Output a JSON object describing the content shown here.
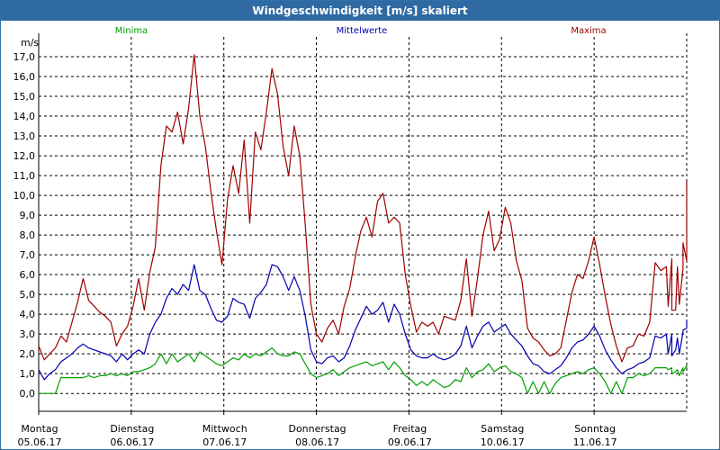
{
  "window": {
    "title": "Windgeschwindigkeit [m/s] skaliert"
  },
  "colors": {
    "min": "#00a000",
    "mean": "#0000b0",
    "max": "#a00000",
    "grid": "#000000",
    "titlebar": "#2f6aa3"
  },
  "chart_data": {
    "type": "line",
    "title": "Windgeschwindigkeit [m/s] skaliert",
    "ylabel": "m/s",
    "ylim": [
      -0.9,
      18.0
    ],
    "xlim": [
      0,
      7
    ],
    "yticks": [
      "0,0",
      "1,0",
      "2,0",
      "3,0",
      "4,0",
      "5,0",
      "6,0",
      "7,0",
      "8,0",
      "9,0",
      "10,0",
      "11,0",
      "12,0",
      "13,0",
      "14,0",
      "15,0",
      "16,0",
      "17,0"
    ],
    "x_ticks": [
      {
        "day": "Montag",
        "date": "05.06.17"
      },
      {
        "day": "Dienstag",
        "date": "06.06.17"
      },
      {
        "day": "Mittwoch",
        "date": "07.06.17"
      },
      {
        "day": "Donnerstag",
        "date": "08.06.17"
      },
      {
        "day": "Freitag",
        "date": "09.06.17"
      },
      {
        "day": "Samstag",
        "date": "10.06.17"
      },
      {
        "day": "Sonntag",
        "date": "11.06.17"
      }
    ],
    "grid": true,
    "legend": [
      "Minima",
      "Mittelwerte",
      "Maxima"
    ],
    "series": [
      {
        "name": "Maxima",
        "x": [
          0,
          0.06,
          0.12,
          0.18,
          0.24,
          0.3,
          0.36,
          0.42,
          0.48,
          0.54,
          0.6,
          0.66,
          0.72,
          0.78,
          0.84,
          0.9,
          0.96,
          1.02,
          1.08,
          1.14,
          1.2,
          1.26,
          1.32,
          1.38,
          1.44,
          1.5,
          1.56,
          1.62,
          1.68,
          1.74,
          1.8,
          1.86,
          1.92,
          1.98,
          2.04,
          2.1,
          2.16,
          2.22,
          2.28,
          2.34,
          2.4,
          2.46,
          2.52,
          2.58,
          2.64,
          2.7,
          2.76,
          2.82,
          2.88,
          2.94,
          3.0,
          3.06,
          3.12,
          3.18,
          3.24,
          3.3,
          3.36,
          3.42,
          3.48,
          3.54,
          3.6,
          3.66,
          3.72,
          3.78,
          3.84,
          3.9,
          3.96,
          4.02,
          4.08,
          4.14,
          4.2,
          4.26,
          4.32,
          4.38,
          4.44,
          4.5,
          4.56,
          4.62,
          4.68,
          4.74,
          4.8,
          4.86,
          4.92,
          4.98,
          5.04,
          5.1,
          5.16,
          5.22,
          5.28,
          5.34,
          5.4,
          5.46,
          5.52,
          5.58,
          5.64,
          5.7,
          5.76,
          5.82,
          5.88,
          5.94,
          6.0,
          6.06,
          6.12,
          6.18,
          6.24,
          6.3,
          6.36,
          6.42,
          6.48,
          6.54,
          6.6,
          6.66,
          6.72,
          6.78,
          6.84,
          6.9,
          6.96,
          7.0
        ],
        "values": [
          2.4,
          1.7,
          2.0,
          2.3,
          2.9,
          2.6,
          3.6,
          4.6,
          5.8,
          4.7,
          4.4,
          4.1,
          3.9,
          3.6,
          2.4,
          3.0,
          3.4,
          4.4,
          5.8,
          4.2,
          6.1,
          7.4,
          11.5,
          13.5,
          13.2,
          14.2,
          12.6,
          14.4,
          17.1,
          14.0,
          12.5,
          10.2,
          8.2,
          6.5,
          9.8,
          11.5,
          10.1,
          12.8,
          8.6,
          13.2,
          12.3,
          14.2,
          16.4,
          15.1,
          12.5,
          11.0,
          13.5,
          12.0,
          8.5,
          4.5,
          3.0,
          2.6,
          3.3,
          3.7,
          3.0,
          4.4,
          5.3,
          6.9,
          8.2,
          8.9,
          7.9,
          9.7,
          10.1,
          8.6,
          8.9,
          8.6,
          6.0,
          4.4,
          3.1,
          3.6,
          3.4,
          3.6,
          3.0,
          3.9,
          3.8,
          3.7,
          4.7,
          6.8,
          3.9,
          5.8,
          8.0,
          9.2,
          7.2,
          7.8,
          9.4,
          8.6,
          6.7,
          5.7,
          3.3,
          2.8,
          2.6,
          2.2,
          1.9,
          2.0,
          2.3,
          3.7,
          5.1,
          6.0,
          5.8,
          6.7,
          7.9,
          6.5,
          4.9,
          3.5,
          2.4,
          1.6,
          2.3,
          2.4,
          3.0,
          2.9,
          3.6,
          6.6,
          6.2,
          6.4,
          6.8,
          6.4,
          6.3,
          6.7
        ],
        "tail": [
          4.4,
          4.2,
          4.2,
          4.5,
          7.6,
          10.7
        ]
      },
      {
        "name": "Mittelwerte",
        "x": [
          0,
          0.06,
          0.12,
          0.18,
          0.24,
          0.3,
          0.36,
          0.42,
          0.48,
          0.54,
          0.6,
          0.66,
          0.72,
          0.78,
          0.84,
          0.9,
          0.96,
          1.02,
          1.08,
          1.14,
          1.2,
          1.26,
          1.32,
          1.38,
          1.44,
          1.5,
          1.56,
          1.62,
          1.68,
          1.74,
          1.8,
          1.86,
          1.92,
          1.98,
          2.04,
          2.1,
          2.16,
          2.22,
          2.28,
          2.34,
          2.4,
          2.46,
          2.52,
          2.58,
          2.64,
          2.7,
          2.76,
          2.82,
          2.88,
          2.94,
          3.0,
          3.06,
          3.12,
          3.18,
          3.24,
          3.3,
          3.36,
          3.42,
          3.48,
          3.54,
          3.6,
          3.66,
          3.72,
          3.78,
          3.84,
          3.9,
          3.96,
          4.02,
          4.08,
          4.14,
          4.2,
          4.26,
          4.32,
          4.38,
          4.44,
          4.5,
          4.56,
          4.62,
          4.68,
          4.74,
          4.8,
          4.86,
          4.92,
          4.98,
          5.04,
          5.1,
          5.16,
          5.22,
          5.28,
          5.34,
          5.4,
          5.46,
          5.52,
          5.58,
          5.64,
          5.7,
          5.76,
          5.82,
          5.88,
          5.94,
          6.0,
          6.06,
          6.12,
          6.18,
          6.24,
          6.3,
          6.36,
          6.42,
          6.48,
          6.54,
          6.6,
          6.66,
          6.72,
          6.78,
          6.84,
          6.9,
          6.96,
          7.0
        ],
        "values": [
          1.2,
          0.7,
          1.0,
          1.2,
          1.6,
          1.8,
          2.0,
          2.3,
          2.5,
          2.3,
          2.2,
          2.1,
          2.0,
          1.9,
          1.6,
          2.0,
          1.7,
          2.0,
          2.2,
          2.0,
          3.0,
          3.6,
          4.0,
          4.8,
          5.3,
          5.0,
          5.5,
          5.2,
          6.5,
          5.2,
          5.0,
          4.3,
          3.7,
          3.6,
          3.9,
          4.8,
          4.6,
          4.5,
          3.8,
          4.8,
          5.1,
          5.5,
          6.5,
          6.4,
          5.9,
          5.2,
          5.9,
          5.2,
          3.9,
          2.2,
          1.6,
          1.5,
          1.8,
          1.9,
          1.6,
          1.8,
          2.4,
          3.2,
          3.8,
          4.4,
          4.0,
          4.2,
          4.6,
          3.6,
          4.5,
          4.0,
          3.0,
          2.2,
          1.9,
          1.8,
          1.8,
          2.0,
          1.8,
          1.7,
          1.8,
          2.0,
          2.4,
          3.4,
          2.3,
          2.9,
          3.4,
          3.6,
          3.1,
          3.3,
          3.5,
          3.0,
          2.7,
          2.4,
          1.9,
          1.5,
          1.4,
          1.1,
          1.0,
          1.2,
          1.4,
          1.8,
          2.3,
          2.6,
          2.7,
          3.0,
          3.4,
          2.9,
          2.2,
          1.7,
          1.3,
          1.0,
          1.2,
          1.3,
          1.5,
          1.6,
          1.8,
          2.9,
          2.8,
          3.0,
          3.0,
          2.8,
          3.1,
          3.3
        ],
        "tail": [
          2.0,
          1.9,
          2.2,
          2.0,
          3.2,
          3.7
        ]
      },
      {
        "name": "Minima",
        "x": [
          0,
          0.06,
          0.12,
          0.18,
          0.24,
          0.3,
          0.36,
          0.42,
          0.48,
          0.54,
          0.6,
          0.66,
          0.72,
          0.78,
          0.84,
          0.9,
          0.96,
          1.02,
          1.08,
          1.14,
          1.2,
          1.26,
          1.32,
          1.38,
          1.44,
          1.5,
          1.56,
          1.62,
          1.68,
          1.74,
          1.8,
          1.86,
          1.92,
          1.98,
          2.04,
          2.1,
          2.16,
          2.22,
          2.28,
          2.34,
          2.4,
          2.46,
          2.52,
          2.58,
          2.64,
          2.7,
          2.76,
          2.82,
          2.88,
          2.94,
          3.0,
          3.06,
          3.12,
          3.18,
          3.24,
          3.3,
          3.36,
          3.42,
          3.48,
          3.54,
          3.6,
          3.66,
          3.72,
          3.78,
          3.84,
          3.9,
          3.96,
          4.02,
          4.08,
          4.14,
          4.2,
          4.26,
          4.32,
          4.38,
          4.44,
          4.5,
          4.56,
          4.62,
          4.68,
          4.74,
          4.8,
          4.86,
          4.92,
          4.98,
          5.04,
          5.1,
          5.16,
          5.22,
          5.28,
          5.34,
          5.4,
          5.46,
          5.52,
          5.58,
          5.64,
          5.7,
          5.76,
          5.82,
          5.88,
          5.94,
          6.0,
          6.06,
          6.12,
          6.18,
          6.24,
          6.3,
          6.36,
          6.42,
          6.48,
          6.54,
          6.6,
          6.66,
          6.72,
          6.78,
          6.84,
          6.9,
          6.96,
          7.0
        ],
        "values": [
          0.0,
          0.0,
          0.0,
          0.0,
          0.8,
          0.8,
          0.8,
          0.8,
          0.8,
          0.9,
          0.8,
          0.9,
          0.9,
          1.0,
          0.9,
          1.0,
          0.9,
          1.1,
          1.1,
          1.2,
          1.3,
          1.5,
          2.0,
          1.5,
          2.0,
          1.6,
          1.8,
          2.0,
          1.6,
          2.1,
          1.9,
          1.7,
          1.5,
          1.4,
          1.6,
          1.8,
          1.7,
          2.0,
          1.8,
          2.0,
          1.9,
          2.1,
          2.3,
          2.0,
          1.9,
          1.9,
          2.1,
          2.0,
          1.5,
          1.0,
          0.8,
          0.9,
          1.0,
          1.2,
          0.9,
          1.1,
          1.3,
          1.4,
          1.5,
          1.6,
          1.4,
          1.5,
          1.6,
          1.2,
          1.6,
          1.3,
          0.9,
          0.7,
          0.4,
          0.6,
          0.4,
          0.7,
          0.5,
          0.3,
          0.4,
          0.7,
          0.6,
          1.3,
          0.8,
          1.1,
          1.2,
          1.5,
          1.1,
          1.3,
          1.4,
          1.1,
          1.0,
          0.8,
          0.0,
          0.6,
          0.0,
          0.6,
          0.0,
          0.5,
          0.8,
          0.9,
          1.0,
          1.1,
          1.0,
          1.2,
          1.3,
          1.0,
          0.6,
          0.0,
          0.6,
          0.0,
          0.8,
          0.8,
          1.0,
          0.9,
          1.0,
          1.3,
          1.3,
          1.3,
          1.3,
          1.2,
          1.3,
          1.4
        ],
        "tail": [
          1.2,
          1.0,
          1.1,
          0.9,
          1.1,
          1.3
        ]
      }
    ]
  }
}
